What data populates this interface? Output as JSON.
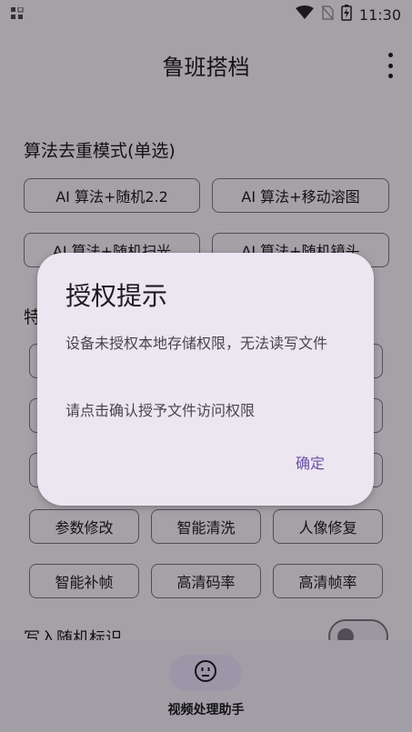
{
  "status_bar": {
    "time": "11:30"
  },
  "app_bar": {
    "title": "鲁班搭档"
  },
  "sections": {
    "dedupe_title": "算法去重模式(单选)",
    "dedupe_chips": [
      "AI 算法+随机2.2",
      "AI 算法+移动溶图",
      "AI 算法+随机扫光",
      "AI 算法+随机镜头"
    ],
    "feature_title": "特",
    "feature_chips_row1": [
      "参数修改",
      "智能清洗",
      "人像修复"
    ],
    "feature_chips_row2": [
      "智能补帧",
      "高清码率",
      "高清帧率"
    ],
    "toggle_label": "写入随机标识"
  },
  "bottom_nav": {
    "label": "视频处理助手"
  },
  "dialog": {
    "title": "授权提示",
    "message1": "设备未授权本地存储权限，无法读写文件",
    "message2": "请点击确认授予文件访问权限",
    "confirm": "确定"
  }
}
